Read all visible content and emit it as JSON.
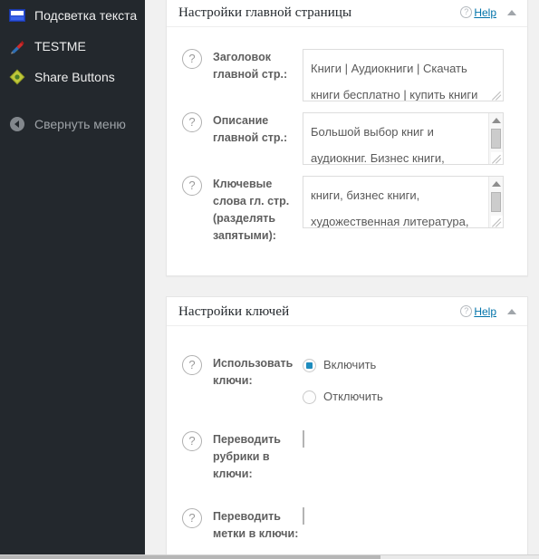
{
  "sidebar": {
    "items": [
      {
        "label": "Подсветка текста",
        "icon": "highlight-icon"
      },
      {
        "label": "TESTME",
        "icon": "pen-icon"
      },
      {
        "label": "Share Buttons",
        "icon": "diamond-share-icon"
      }
    ],
    "collapse": {
      "label": "Свернуть меню",
      "icon": "collapse-arrow-icon"
    }
  },
  "panels": [
    {
      "id": "home-settings",
      "title": "Настройки главной страницы",
      "help_label": "Help",
      "toggle_icon": "chevron-up-icon",
      "rows": [
        {
          "label": "Заголовок главной стр.:",
          "help_icon": "question-mark-icon",
          "type": "textarea",
          "value": "Книги | Аудиокниги | Скачать книги бесплатно | купить книги",
          "has_scrollbar": false,
          "has_resize_grip": true
        },
        {
          "label": "Описание главной стр.:",
          "help_icon": "question-mark-icon",
          "type": "textarea",
          "value": "Большой выбор книг и аудиокниг. Бизнес книги,",
          "has_scrollbar": true,
          "has_resize_grip": true
        },
        {
          "label": "Ключевые слова гл. стр. (разделять запятыми):",
          "help_icon": "question-mark-icon",
          "type": "textarea",
          "value": "книги, бизнес книги, художественная литература,",
          "has_scrollbar": true,
          "has_resize_grip": true
        }
      ]
    },
    {
      "id": "keys-settings",
      "title": "Настройки ключей",
      "help_label": "Help",
      "toggle_icon": "chevron-up-icon",
      "rows": [
        {
          "label": "Использовать ключи:",
          "help_icon": "question-mark-icon",
          "type": "radio",
          "options": [
            {
              "label": "Включить",
              "selected": true
            },
            {
              "label": "Отключить",
              "selected": false
            }
          ]
        },
        {
          "label": "Переводить рубрики в ключи:",
          "help_icon": "question-mark-icon",
          "type": "checkbox",
          "checked": false
        },
        {
          "label": "Переводить метки в ключи:",
          "help_icon": "question-mark-icon",
          "type": "checkbox",
          "checked": false
        }
      ]
    }
  ],
  "colors": {
    "sidebar_bg": "#23282d",
    "page_bg": "#f1f1f1",
    "panel_bg": "#ffffff",
    "link_blue": "#0073aa",
    "radio_blue": "#1e8cbe",
    "label_gray": "#5f5f5f"
  }
}
